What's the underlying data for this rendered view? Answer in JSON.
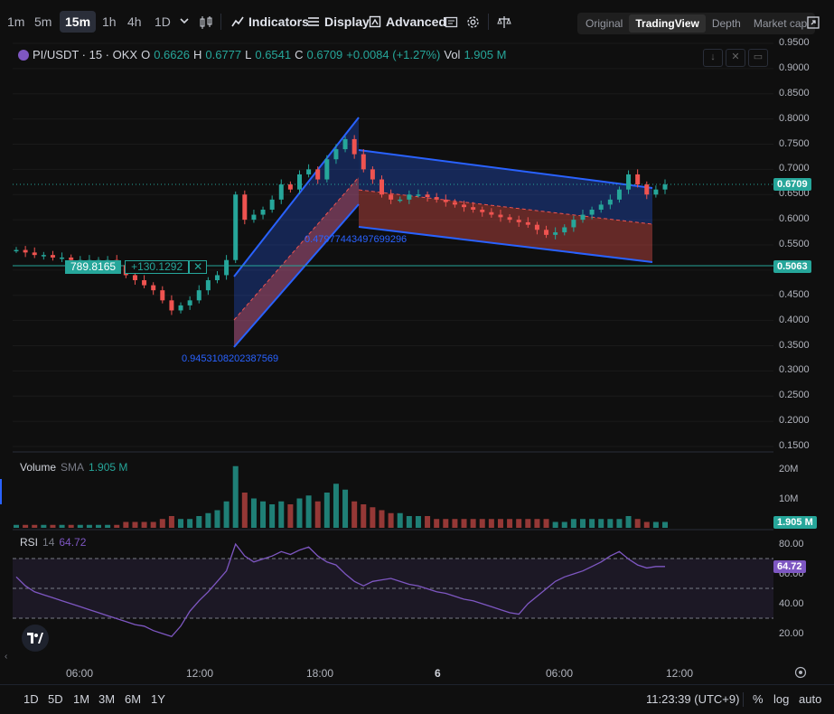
{
  "toolbar": {
    "timeframes": [
      "1m",
      "5m",
      "15m",
      "1h",
      "4h",
      "1D"
    ],
    "active_timeframe": "15m",
    "indicators_label": "Indicators",
    "display_label": "Display",
    "advanced_label": "Advanced",
    "view_tabs": [
      "Original",
      "TradingView",
      "Depth",
      "Market cap"
    ],
    "active_view": "TradingView"
  },
  "legend": {
    "symbol": "PI/USDT · 15 · OKX",
    "o_key": "O",
    "o_val": "0.6626",
    "h_key": "H",
    "h_val": "0.6777",
    "l_key": "L",
    "l_val": "0.6541",
    "c_key": "C",
    "c_val": "0.6709",
    "change": "+0.0084 (+1.27%)",
    "vol_key": "Vol",
    "vol_val": "1.905 M"
  },
  "price_axis": {
    "ticks": [
      "0.9500",
      "0.9000",
      "0.8500",
      "0.8000",
      "0.7500",
      "0.7000",
      "0.6500",
      "0.6000",
      "0.5500",
      "0.5000",
      "0.4500",
      "0.4000",
      "0.3500",
      "0.3000",
      "0.2500",
      "0.2000",
      "0.1500"
    ],
    "last_price": "0.6709",
    "line_price": "0.5063",
    "last_price_color": "#26a69a"
  },
  "position_tool": {
    "left_value": "789.8165",
    "right_value": "+130.1292",
    "close": "✕"
  },
  "channel_labels": {
    "up_channel": "0.9453108202387569",
    "down_channel": "0.47977443497699296"
  },
  "volume_pane": {
    "title": "Volume",
    "sma_label": "SMA",
    "value": "1.905 M",
    "ticks": [
      "20M",
      "10M"
    ],
    "last_badge": "1.905 M"
  },
  "rsi_pane": {
    "title": "RSI",
    "length": "14",
    "value": "64.72",
    "ticks": [
      "80.00",
      "60.00",
      "40.00",
      "20.00"
    ],
    "last_badge": "64.72"
  },
  "time_axis": {
    "ticks": [
      "06:00",
      "12:00",
      "18:00",
      "6",
      "06:00",
      "12:00"
    ]
  },
  "bottom": {
    "ranges": [
      "1D",
      "5D",
      "1M",
      "3M",
      "6M",
      "1Y"
    ],
    "clock": "11:23:39 (UTC+9)",
    "percent": "%",
    "log": "log",
    "auto": "auto"
  },
  "colors": {
    "up": "#26a69a",
    "down": "#ef5350",
    "channel_blue": "#2962ff",
    "rsi_line": "#7e57c2"
  },
  "chart_data": {
    "type": "candlestick",
    "symbol": "PI/USDT",
    "interval": "15m",
    "ylim": [
      0.15,
      0.95
    ],
    "close_path": [
      0.54,
      0.535,
      0.53,
      0.53,
      0.525,
      0.525,
      0.52,
      0.52,
      0.52,
      0.52,
      0.52,
      0.51,
      0.49,
      0.48,
      0.47,
      0.46,
      0.44,
      0.42,
      0.43,
      0.44,
      0.46,
      0.48,
      0.49,
      0.52,
      0.65,
      0.6,
      0.61,
      0.62,
      0.64,
      0.67,
      0.66,
      0.69,
      0.7,
      0.68,
      0.72,
      0.74,
      0.76,
      0.73,
      0.7,
      0.68,
      0.65,
      0.64,
      0.64,
      0.65,
      0.65,
      0.645,
      0.64,
      0.635,
      0.63,
      0.625,
      0.62,
      0.615,
      0.61,
      0.605,
      0.6,
      0.595,
      0.59,
      0.58,
      0.57,
      0.575,
      0.585,
      0.6,
      0.61,
      0.62,
      0.63,
      0.64,
      0.66,
      0.69,
      0.67,
      0.65,
      0.66,
      0.67
    ],
    "volume_m": [
      1,
      1,
      1,
      1,
      1,
      1,
      1,
      1,
      1,
      1,
      1,
      1,
      2,
      2,
      2,
      2,
      3,
      4,
      3,
      3,
      4,
      5,
      6,
      9,
      21,
      12,
      10,
      9,
      8,
      9,
      8,
      10,
      11,
      9,
      12,
      15,
      13,
      9,
      8,
      7,
      6,
      5,
      5,
      4,
      4,
      4,
      3,
      3,
      3,
      3,
      3,
      3,
      3,
      3,
      3,
      3,
      3,
      3,
      3,
      2,
      2,
      3,
      3,
      3,
      3,
      3,
      3,
      4,
      3,
      2,
      2,
      2
    ],
    "rsi": [
      58,
      52,
      48,
      46,
      44,
      42,
      40,
      38,
      36,
      34,
      32,
      30,
      28,
      26,
      25,
      22,
      20,
      18,
      25,
      35,
      42,
      48,
      55,
      62,
      80,
      72,
      68,
      70,
      72,
      75,
      73,
      76,
      78,
      72,
      68,
      66,
      60,
      55,
      52,
      55,
      56,
      57,
      55,
      53,
      52,
      50,
      48,
      47,
      45,
      43,
      42,
      40,
      38,
      36,
      34,
      33,
      40,
      45,
      50,
      55,
      58,
      60,
      62,
      65,
      68,
      72,
      75,
      70,
      66,
      64,
      65,
      65
    ]
  }
}
